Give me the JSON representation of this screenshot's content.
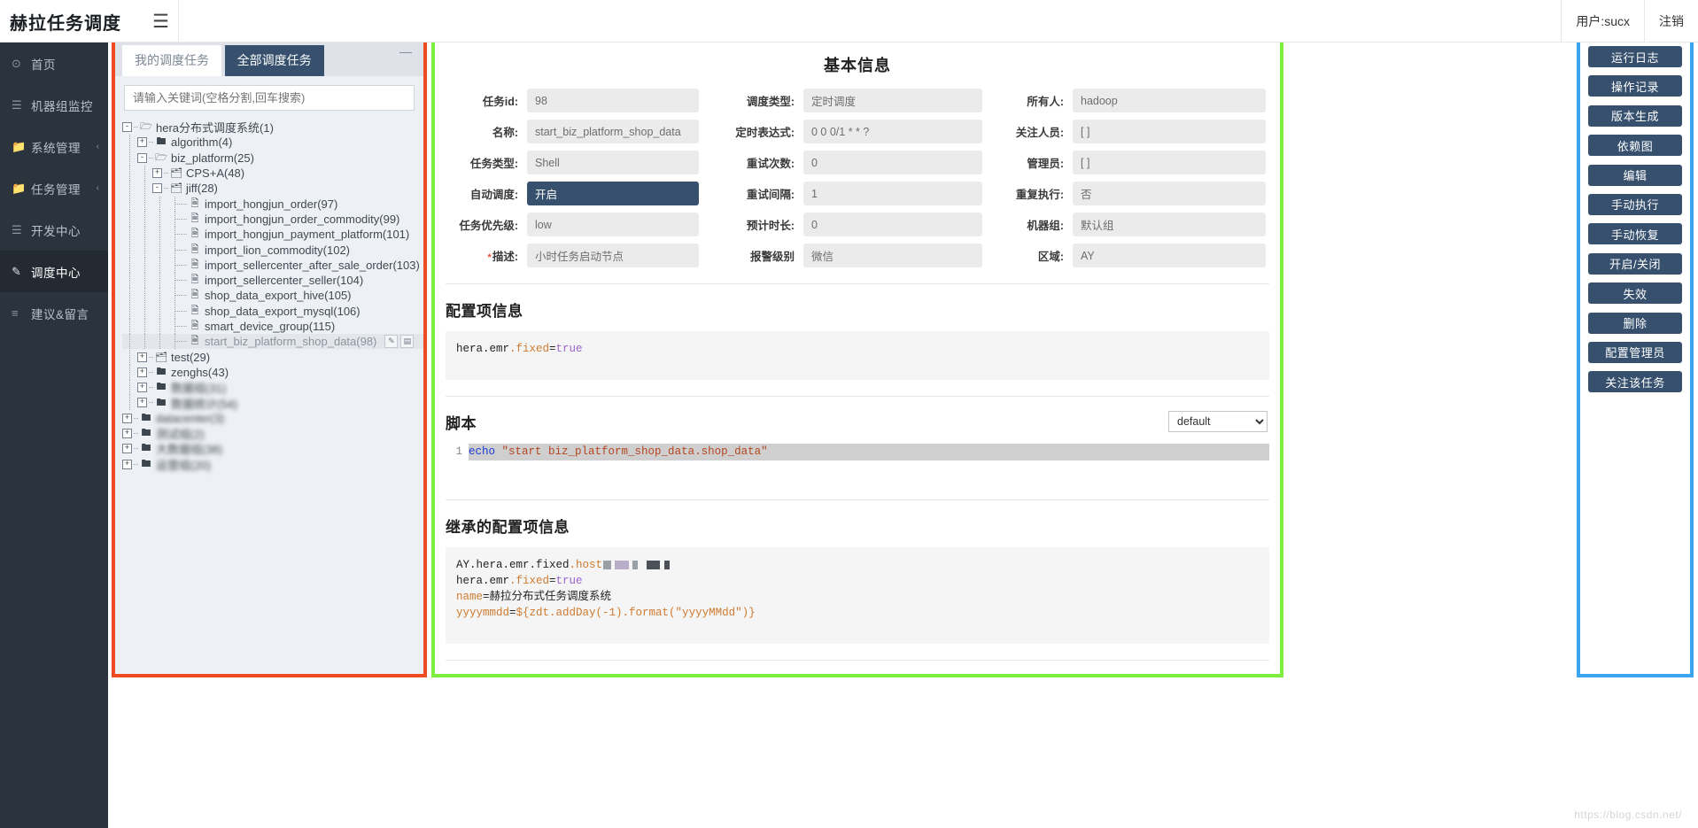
{
  "topbar": {
    "brand": "赫拉任务调度",
    "hamburger_icon": "hamburger-menu-icon",
    "user": "用户:sucx",
    "logout": "注销"
  },
  "sidebar": {
    "items": [
      {
        "label": "首页",
        "icon": "dashboard-icon",
        "arrow": "",
        "active": false
      },
      {
        "label": "机器组监控",
        "icon": "server-icon",
        "arrow": "",
        "active": false
      },
      {
        "label": "系统管理",
        "icon": "folder-icon",
        "arrow": "‹",
        "active": false
      },
      {
        "label": "任务管理",
        "icon": "folder-icon",
        "arrow": "‹",
        "active": false
      },
      {
        "label": "开发中心",
        "icon": "book-icon",
        "arrow": "",
        "active": false
      },
      {
        "label": "调度中心",
        "icon": "edit-square-icon",
        "arrow": "",
        "active": true
      },
      {
        "label": "建议&留言",
        "icon": "comment-icon",
        "arrow": "",
        "active": false
      }
    ]
  },
  "left_panel": {
    "tabs": [
      {
        "label": "我的调度任务",
        "active": false
      },
      {
        "label": "全部调度任务",
        "active": true
      }
    ],
    "minimize_icon": "minimize-icon",
    "search_placeholder": "请输入关键词(空格分割,回车搜索)",
    "tree": [
      {
        "depth": 0,
        "toggle": "-",
        "icon": "folder-open-icon",
        "label": "hera分布式调度系统(1)",
        "selected": false,
        "blur": false
      },
      {
        "depth": 1,
        "toggle": "+",
        "icon": "folder-icon",
        "label": "algorithm(4)",
        "selected": false,
        "blur": false
      },
      {
        "depth": 1,
        "toggle": "-",
        "icon": "folder-open-icon",
        "label": "biz_platform(25)",
        "selected": false,
        "blur": false
      },
      {
        "depth": 2,
        "toggle": "+",
        "icon": "folder-group-icon",
        "label": "CPS+A(48)",
        "selected": false,
        "blur": false
      },
      {
        "depth": 2,
        "toggle": "-",
        "icon": "folder-group-icon",
        "label": "jiff(28)",
        "selected": false,
        "blur": false
      },
      {
        "depth": 3,
        "toggle": "",
        "icon": "file-icon",
        "label": "import_hongjun_order(97)",
        "selected": false,
        "blur": false
      },
      {
        "depth": 3,
        "toggle": "",
        "icon": "file-icon",
        "label": "import_hongjun_order_commodity(99)",
        "selected": false,
        "blur": false
      },
      {
        "depth": 3,
        "toggle": "",
        "icon": "file-icon",
        "label": "import_hongjun_payment_platform(101)",
        "selected": false,
        "blur": false
      },
      {
        "depth": 3,
        "toggle": "",
        "icon": "file-icon",
        "label": "import_lion_commodity(102)",
        "selected": false,
        "blur": false
      },
      {
        "depth": 3,
        "toggle": "",
        "icon": "file-icon",
        "label": "import_sellercenter_after_sale_order(103)",
        "selected": false,
        "blur": false
      },
      {
        "depth": 3,
        "toggle": "",
        "icon": "file-icon",
        "label": "import_sellercenter_seller(104)",
        "selected": false,
        "blur": false
      },
      {
        "depth": 3,
        "toggle": "",
        "icon": "file-icon",
        "label": "shop_data_export_hive(105)",
        "selected": false,
        "blur": false
      },
      {
        "depth": 3,
        "toggle": "",
        "icon": "file-icon",
        "label": "shop_data_export_mysql(106)",
        "selected": false,
        "blur": false
      },
      {
        "depth": 3,
        "toggle": "",
        "icon": "file-icon",
        "label": "smart_device_group(115)",
        "selected": false,
        "blur": false
      },
      {
        "depth": 3,
        "toggle": "",
        "icon": "file-icon",
        "label": "start_biz_platform_shop_data(98)",
        "selected": true,
        "blur": false
      },
      {
        "depth": 1,
        "toggle": "+",
        "icon": "folder-group-icon",
        "label": "test(29)",
        "selected": false,
        "blur": false
      },
      {
        "depth": 1,
        "toggle": "+",
        "icon": "folder-icon",
        "label": "zenghs(43)",
        "selected": false,
        "blur": false
      },
      {
        "depth": 1,
        "toggle": "+",
        "icon": "folder-icon",
        "label": "数据组(31)",
        "selected": false,
        "blur": true
      },
      {
        "depth": 1,
        "toggle": "+",
        "icon": "folder-icon",
        "label": "数据统计(54)",
        "selected": false,
        "blur": true
      },
      {
        "depth": 0,
        "toggle": "+",
        "icon": "folder-icon",
        "label": "datacenter(3)",
        "selected": false,
        "blur": true
      },
      {
        "depth": 0,
        "toggle": "+",
        "icon": "folder-icon",
        "label": "测试组(2)",
        "selected": false,
        "blur": true
      },
      {
        "depth": 0,
        "toggle": "+",
        "icon": "folder-icon",
        "label": "大数据组(38)",
        "selected": false,
        "blur": true
      },
      {
        "depth": 0,
        "toggle": "+",
        "icon": "folder-icon",
        "label": "运营组(20)",
        "selected": false,
        "blur": true
      }
    ],
    "node_actions": [
      {
        "icon": "pencil-icon"
      },
      {
        "icon": "copy-icon"
      }
    ]
  },
  "main": {
    "basic_title": "基本信息",
    "form_rows": [
      [
        {
          "label": "任务id:",
          "value": "98",
          "required": false,
          "highlight": false
        },
        {
          "label": "调度类型:",
          "value": "定时调度",
          "required": false,
          "highlight": false
        },
        {
          "label": "所有人:",
          "value": "hadoop",
          "required": false,
          "highlight": false
        }
      ],
      [
        {
          "label": "名称:",
          "value": "start_biz_platform_shop_data",
          "required": false,
          "highlight": false
        },
        {
          "label": "定时表达式:",
          "value": "0 0 0/1 * * ?",
          "required": false,
          "highlight": false
        },
        {
          "label": "关注人员:",
          "value": "[ ]",
          "required": false,
          "highlight": false
        }
      ],
      [
        {
          "label": "任务类型:",
          "value": "Shell",
          "required": false,
          "highlight": false
        },
        {
          "label": "重试次数:",
          "value": "0",
          "required": false,
          "highlight": false
        },
        {
          "label": "管理员:",
          "value": "[ ]",
          "required": false,
          "highlight": false
        }
      ],
      [
        {
          "label": "自动调度:",
          "value": "开启",
          "required": false,
          "highlight": true
        },
        {
          "label": "重试间隔:",
          "value": "1",
          "required": false,
          "highlight": false
        },
        {
          "label": "重复执行:",
          "value": "否",
          "required": false,
          "highlight": false
        }
      ],
      [
        {
          "label": "任务优先级:",
          "value": "low",
          "required": false,
          "highlight": false
        },
        {
          "label": "预计时长:",
          "value": "0",
          "required": false,
          "highlight": false
        },
        {
          "label": "机器组:",
          "value": "默认组",
          "required": false,
          "highlight": false
        }
      ],
      [
        {
          "label": "描述:",
          "value": "小时任务启动节点",
          "required": true,
          "highlight": false
        },
        {
          "label": "报警级别",
          "value": "微信",
          "required": false,
          "highlight": false
        },
        {
          "label": "区域:",
          "value": "AY",
          "required": false,
          "highlight": false
        }
      ]
    ],
    "config_section": {
      "title": "配置项信息",
      "lines": [
        {
          "key": "hera.emr",
          "dot_key": ".fixed",
          "eq": "=",
          "val": "true"
        }
      ],
      "raw": "hera.emr.fixed=true"
    },
    "script_section": {
      "title": "脚本",
      "select_value": "default",
      "select_options": [
        "default"
      ],
      "line_number": "1",
      "code_cmd": "echo",
      "code_str": "\"start biz_platform_shop_data.shop_data\"",
      "raw": "echo \"start biz_platform_shop_data.shop_data\""
    },
    "inherited_section": {
      "title": "继承的配置项信息",
      "lines": [
        {
          "prefix": "AY.hera.emr.fixed",
          "key": ".host",
          "value_masked": true,
          "value": ""
        },
        {
          "prefix": "hera.emr",
          "key": ".fixed",
          "eq": "=",
          "value": "true"
        },
        {
          "prefix": "",
          "key": "name",
          "eq": "=",
          "value": "赫拉分布式任务调度系统"
        },
        {
          "prefix": "",
          "key": "yyyymmdd",
          "eq": "=",
          "value": "${zdt.addDay(-1).format(\"yyyyMMdd\")}"
        }
      ]
    }
  },
  "right_panel": {
    "buttons": [
      {
        "label": "运行日志"
      },
      {
        "label": "操作记录"
      },
      {
        "label": "版本生成"
      },
      {
        "label": "依赖图"
      },
      {
        "label": "编辑"
      },
      {
        "label": "手动执行"
      },
      {
        "label": "手动恢复"
      },
      {
        "label": "开启/关闭"
      },
      {
        "label": "失效"
      },
      {
        "label": "删除"
      },
      {
        "label": "配置管理员"
      },
      {
        "label": "关注该任务"
      }
    ]
  },
  "watermark": "https://blog.csdn.net/",
  "colors": {
    "sidebar_bg": "#2b333c",
    "accent_dark": "#36506e",
    "outline_red": "#f04a22",
    "outline_green": "#7ded3e",
    "outline_blue": "#3ca5ef",
    "field_bg": "#ebebeb"
  }
}
